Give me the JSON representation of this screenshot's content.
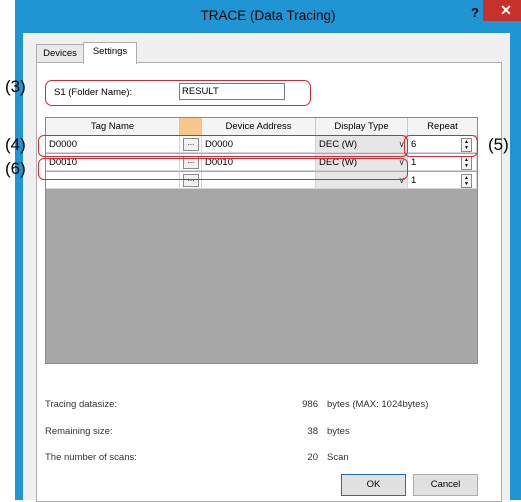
{
  "window": {
    "title": "TRACE (Data Tracing)",
    "help_label": "?",
    "close_label": "✕"
  },
  "tabs": [
    {
      "label": "Devices"
    },
    {
      "label": "Settings"
    }
  ],
  "callouts": {
    "c3": "(3)",
    "c4": "(4)",
    "c5": "(5)",
    "c6": "(6)"
  },
  "folder": {
    "label": "S1 (Folder Name):",
    "value": "RESULT"
  },
  "grid": {
    "columns": {
      "tag_name": "Tag Name",
      "device_address": "Device Address",
      "display_type": "Display Type",
      "repeat": "Repeat"
    },
    "browse_label": "...",
    "rows": [
      {
        "tag_name": "D0000",
        "device_address": "D0000",
        "display_type": "DEC (W)",
        "repeat": "6"
      },
      {
        "tag_name": "D0010",
        "device_address": "D0010",
        "display_type": "DEC (W)",
        "repeat": "1"
      },
      {
        "tag_name": "",
        "device_address": "",
        "display_type": "",
        "repeat": "1"
      }
    ]
  },
  "info": {
    "datasize_label": "Tracing datasize:",
    "datasize_value": "986",
    "datasize_unit": "bytes (MAX: 1024bytes)",
    "remaining_label": "Remaining size:",
    "remaining_value": "38",
    "remaining_unit": "bytes",
    "scans_label": "The number of scans:",
    "scans_value": "20",
    "scans_unit": "Scan"
  },
  "buttons": {
    "ok": "OK",
    "cancel": "Cancel"
  }
}
